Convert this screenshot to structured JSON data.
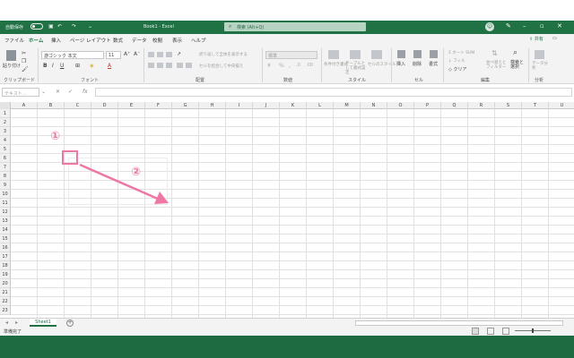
{
  "titlebar": {
    "autosave_label": "自動保存",
    "autosave_state": "オフ",
    "title": "Book1 - Excel",
    "search_placeholder": "検索 (Alt+Q)"
  },
  "tabs": [
    "ファイル",
    "ホーム",
    "挿入",
    "ページ レイアウト",
    "数式",
    "データ",
    "校閲",
    "表示",
    "ヘルプ"
  ],
  "active_tab": "ホーム",
  "share_label": "共有",
  "ribbon": {
    "clipboard_label": "クリップボード",
    "paste_label": "貼り付け",
    "font_label": "フォント",
    "font_name": "游ゴシック 本文",
    "font_size": "11",
    "alignment_label": "配置",
    "wrap_text": "折り返して全体を表示する",
    "merge_center": "セルを結合して中央揃え",
    "number_label": "数値",
    "number_format": "標準",
    "styles_label": "スタイル",
    "cond_format": "条件付き書式",
    "format_table": "テーブルとして書式設定",
    "cell_styles": "セルのスタイル",
    "cells_label": "セル",
    "insert": "挿入",
    "delete": "削除",
    "format": "書式",
    "editing_label": "編集",
    "autosum": "オート SUM",
    "fill": "フィル",
    "clear": "クリア",
    "sort_filter": "並べ替えとフィルター",
    "find_select": "検索と選択",
    "analysis_label": "分析",
    "analyze_data": "データ分析"
  },
  "formula_bar": {
    "namebox_placeholder": "テキスト..."
  },
  "columns": [
    "A",
    "B",
    "C",
    "D",
    "E",
    "F",
    "G",
    "H",
    "I",
    "J",
    "K",
    "L",
    "M",
    "N",
    "O",
    "P",
    "Q",
    "R",
    "S",
    "T",
    "U"
  ],
  "rows": [
    "1",
    "2",
    "3",
    "4",
    "5",
    "6",
    "7",
    "8",
    "9",
    "10",
    "11",
    "12",
    "13",
    "14",
    "15",
    "16",
    "17",
    "18",
    "19",
    "20",
    "21",
    "22",
    "23"
  ],
  "sheet_tab": "Sheet1",
  "status": "準備完了",
  "annotations": {
    "step1": "①",
    "step2": "②"
  },
  "colors": {
    "excel_green": "#207245",
    "annotation_pink": "#ee77a6"
  }
}
